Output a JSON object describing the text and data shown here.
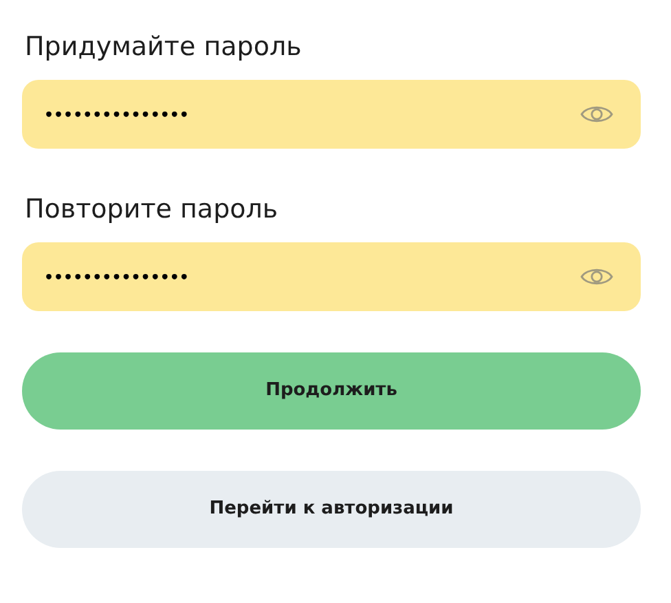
{
  "fields": [
    {
      "label": "Придумайте пароль",
      "value": "•••••••••••••••"
    },
    {
      "label": "Повторите пароль",
      "value": "•••••••••••••••"
    }
  ],
  "buttons": [
    {
      "label": "Продолжить",
      "kind": "primary"
    },
    {
      "label": "Перейти к авторизации",
      "kind": "secondary"
    }
  ]
}
